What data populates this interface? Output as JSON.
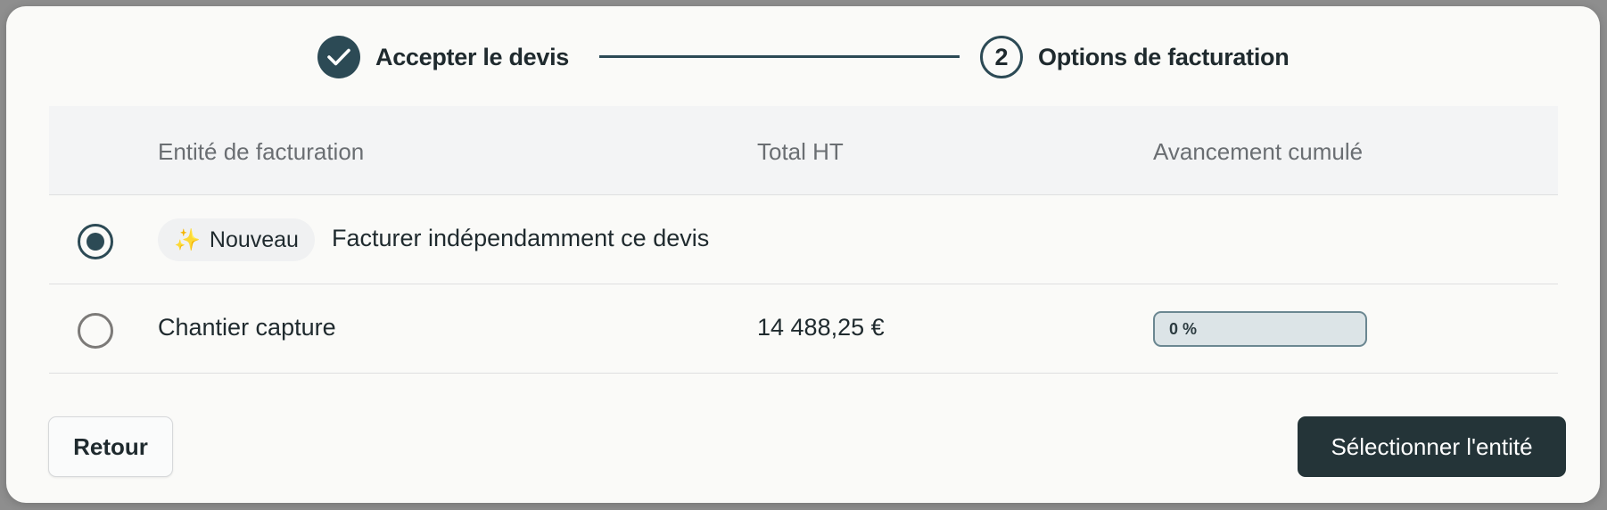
{
  "stepper": {
    "step1": {
      "label": "Accepter le devis",
      "state": "done"
    },
    "step2": {
      "number": "2",
      "label": "Options de facturation",
      "state": "current"
    }
  },
  "table": {
    "columns": [
      "Entité de facturation",
      "Total HT",
      "Avancement cumulé"
    ],
    "rows": [
      {
        "selected": true,
        "badge": "Nouveau",
        "label": "Facturer indépendamment ce devis",
        "total": "",
        "progress": ""
      },
      {
        "selected": false,
        "label": "Chantier capture",
        "total": "14 488,25 €",
        "progress": "0 %",
        "progress_value": 0
      }
    ]
  },
  "footer": {
    "back_label": "Retour",
    "primary_label": "Sélectionner l'entité"
  },
  "colors": {
    "accent": "#2c4a55",
    "primary_button": "#243438",
    "progress_bg": "#dce4e7"
  },
  "icons": {
    "done_step": "check-icon",
    "badge": "sparkles-icon"
  }
}
